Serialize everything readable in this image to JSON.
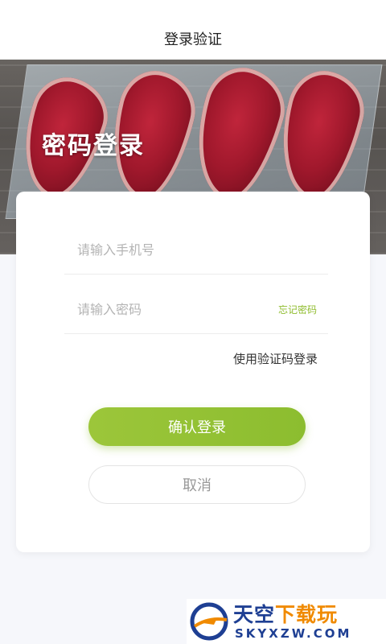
{
  "nav": {
    "title": "登录验证"
  },
  "hero": {
    "title": "密码登录"
  },
  "form": {
    "phone_placeholder": "请输入手机号",
    "password_placeholder": "请输入密码",
    "forgot_password": "忘记密码",
    "sms_login": "使用验证码登录",
    "confirm_button": "确认登录",
    "cancel_button": "取消"
  },
  "watermark": {
    "text_cn_main": "天空",
    "text_cn_accent": "下载玩",
    "text_en": "SKYXZW.COM"
  },
  "colors": {
    "accent": "#8fbc2e",
    "watermark_blue": "#1e3f93",
    "watermark_orange": "#f08a00"
  }
}
